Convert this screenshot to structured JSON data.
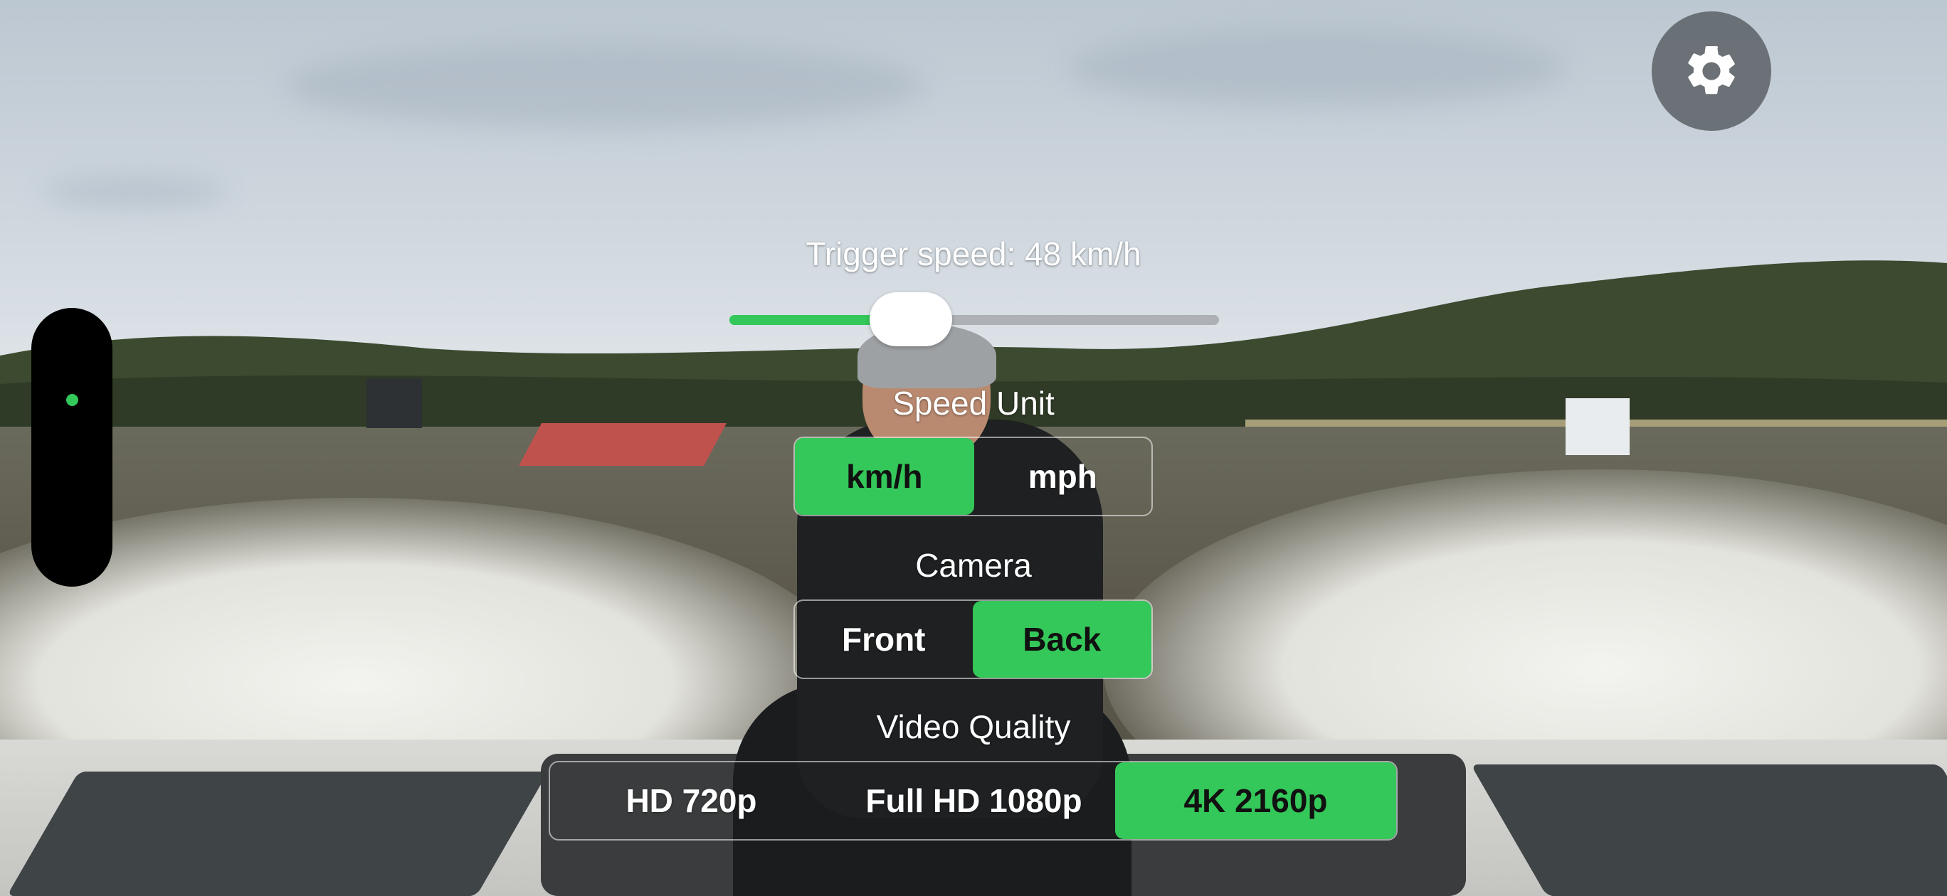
{
  "settings": {
    "icon": "gear-icon"
  },
  "trigger": {
    "label": "Trigger speed: 48 km/h",
    "slider_fraction": 0.37
  },
  "speed_unit": {
    "title": "Speed Unit",
    "options": [
      "km/h",
      "mph"
    ],
    "selected": "km/h"
  },
  "camera": {
    "title": "Camera",
    "options": [
      "Front",
      "Back"
    ],
    "selected": "Back"
  },
  "video_quality": {
    "title": "Video Quality",
    "options": [
      "HD 720p",
      "Full HD 1080p",
      "4K 2160p"
    ],
    "selected": "4K 2160p"
  },
  "colors": {
    "accent": "#34c759",
    "indicator": "#34c759"
  }
}
